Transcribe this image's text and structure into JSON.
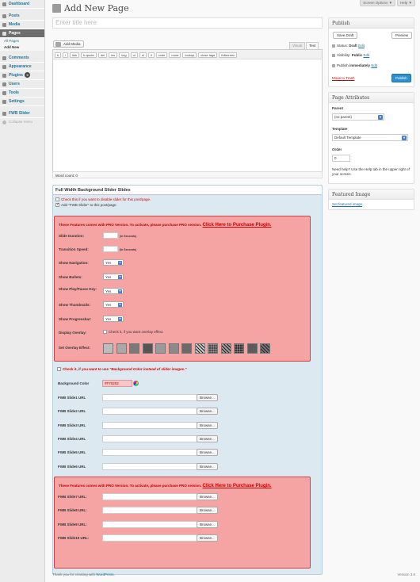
{
  "menu": [
    {
      "label": "Dashboard",
      "icon": "dashboard-icon"
    },
    {
      "label": "Posts",
      "icon": "posts-icon"
    },
    {
      "label": "Media",
      "icon": "media-icon"
    },
    {
      "label": "Pages",
      "icon": "pages-icon",
      "current": true
    },
    {
      "label": "Comments",
      "icon": "comments-icon"
    },
    {
      "label": "Appearance",
      "icon": "appearance-icon"
    },
    {
      "label": "Plugins",
      "icon": "plugins-icon",
      "badge": "0"
    },
    {
      "label": "Users",
      "icon": "users-icon"
    },
    {
      "label": "Tools",
      "icon": "tools-icon"
    },
    {
      "label": "Settings",
      "icon": "settings-icon"
    },
    {
      "label": "FWB Slider",
      "icon": "slider-icon"
    }
  ],
  "submenu": {
    "all_pages": "All Pages",
    "add_new": "Add New"
  },
  "collapse": "Collapse menu",
  "tabs": {
    "screen_options": "Screen Options ▼",
    "help": "Help ▼"
  },
  "page_title": "Add New Page",
  "title_placeholder": "Enter title here",
  "add_media": "Add Media",
  "visual": "Visual",
  "text": "Text",
  "quicktags": [
    "b",
    "i",
    "link",
    "b-quote",
    "del",
    "ins",
    "img",
    "ul",
    "ol",
    "li",
    "code",
    "more",
    "lookup",
    "close tags",
    "fullscreen"
  ],
  "word_count": "Word count: 0",
  "publish": {
    "title": "Publish",
    "save_draft": "Save Draft",
    "preview": "Preview",
    "status_label": "Status:",
    "status_value": "Draft",
    "visibility_label": "Visibility:",
    "visibility_value": "Public",
    "publish_label": "Publish",
    "publish_value": "immediately",
    "edit": "Edit",
    "trash": "Move to Trash",
    "publish_btn": "Publish"
  },
  "attrs": {
    "title": "Page Attributes",
    "parent_label": "Parent",
    "parent_value": "(no parent)",
    "template_label": "Template",
    "template_value": "Default Template",
    "order_label": "Order",
    "order_value": "0",
    "help": "Need help? Use the Help tab in the upper right of your screen."
  },
  "featured": {
    "title": "Featured Image",
    "link": "Set featured image"
  },
  "fwb": {
    "title": "Full Width Background Slider Slides",
    "disable": "Check this if you want to disable slider for this post/page.",
    "add": "Add \"FWB Slider\" to this post/page.",
    "pro_text": "These Features comes with PRO Version. To activate, please purchase PRO version.",
    "pro_link": "Click Here to Purchase Plugin.",
    "slide_duration": "Slide Duration:",
    "transition_speed": "Transition Speed:",
    "in_seconds": "(in Seconds)",
    "show_navigation": "Show Navigation:",
    "show_bullets": "Show Bullets:",
    "show_playpause": "Show Play/Pause Key:",
    "show_thumbnails": "Show Thumbnails:",
    "show_progressbar": "Show Progressbar:",
    "yes": "Yes",
    "display_overlay": "Display Overlay:",
    "overlay_check": "Check it, if you want overlay effect.",
    "set_overlay": "Set Overlay Effect:",
    "bgcolor_check_pre": "Check it, if you want to use",
    "bgcolor_check_em": "\"Background Color instead of slider images.\"",
    "bgcolor_label": "Background Color",
    "bgcolor_value": "#F70202",
    "browse": "Browse...",
    "slides": [
      "FWB Slide1 URL",
      "FWB Slide2 URL",
      "FWB Slide3 URL",
      "FWB Slide4 URL",
      "FWB Slide5 URL",
      "FWB Slide6 URL"
    ],
    "pro_slides": [
      "FWB Slide7 URL:",
      "FWB Slide8 URL:",
      "FWB Slide9 URL:",
      "FWB Slide10 URL:"
    ]
  },
  "overlays": [
    "#bdbdbd",
    "#a8a8a8",
    "#7a7a7a",
    "#555555",
    "#9a9a9a",
    "#8a8a8a",
    "#6a6a6a",
    "#c8c8c8",
    "#4a4a4a",
    "#9c9c9c",
    "#333333",
    "#5c5c5c",
    "#777777"
  ],
  "footer": {
    "thanks": "Thank you for creating with",
    "wp": "WordPress.",
    "version": "Version 3.6"
  }
}
